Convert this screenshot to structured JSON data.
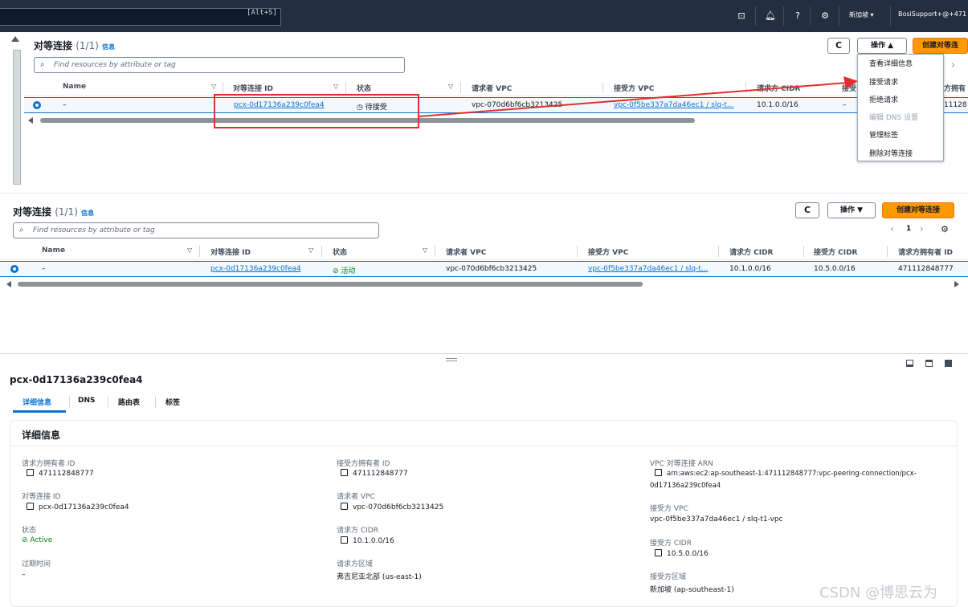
{
  "topbar": {
    "shortcut": "[Alt+S]",
    "region": "新加坡 ▾",
    "account": "BosiSupport+@+471"
  },
  "top_panel": {
    "title": "对等连接",
    "count": "(1/1)",
    "info": "信息",
    "search_placeholder": "Find resources by attribute or tag",
    "refresh": "C",
    "actions": "操作 ▲",
    "create": "创建对等连",
    "columns": [
      "Name",
      "对等连接 ID",
      "状态",
      "请求者 VPC",
      "接受方 VPC",
      "请求方 CIDR",
      "接受",
      "方拥有"
    ],
    "row": {
      "name": "–",
      "id": "pcx-0d17136a239c0fea4",
      "status": "待接受",
      "requester_vpc": "vpc-070d6bf6cb3213425",
      "accepter_vpc": "vpc-0f5be337a7da46ec1 / slq-t...",
      "req_cidr": "10.1.0.0/16",
      "acc_cidr": "–",
      "owner": "11128"
    },
    "menu": [
      "查看详细信息",
      "接受请求",
      "拒绝请求",
      "编辑 DNS 设置",
      "管理标签",
      "删除对等连接"
    ]
  },
  "bottom_panel": {
    "title": "对等连接",
    "count": "(1/1)",
    "info": "信息",
    "search_placeholder": "Find resources by attribute or tag",
    "refresh": "C",
    "actions": "操作 ▼",
    "create": "创建对等连接",
    "page": "1",
    "columns": [
      "Name",
      "对等连接 ID",
      "状态",
      "请求者 VPC",
      "接受方 VPC",
      "请求方 CIDR",
      "接受方 CIDR",
      "请求方拥有者 ID"
    ],
    "row": {
      "name": "–",
      "id": "pcx-0d17136a239c0fea4",
      "status": "活动",
      "requester_vpc": "vpc-070d6bf6cb3213425",
      "accepter_vpc": "vpc-0f5be337a7da46ec1 / slq-t...",
      "req_cidr": "10.1.0.0/16",
      "acc_cidr": "10.5.0.0/16",
      "owner": "471112848777"
    }
  },
  "details": {
    "title": "pcx-0d17136a239c0fea4",
    "tabs": [
      "详细信息",
      "DNS",
      "路由表",
      "标签"
    ],
    "section": "详细信息",
    "col1": [
      {
        "label": "请求方拥有者 ID",
        "value": "471112848777"
      },
      {
        "label": "对等连接 ID",
        "value": "pcx-0d17136a239c0fea4"
      },
      {
        "label": "状态",
        "value": "Active"
      },
      {
        "label": "过期时间",
        "value": "–"
      }
    ],
    "col2": [
      {
        "label": "接受方拥有者 ID",
        "value": "471112848777"
      },
      {
        "label": "请求者 VPC",
        "value": "vpc-070d6bf6cb3213425"
      },
      {
        "label": "请求方 CIDR",
        "value": "10.1.0.0/16"
      },
      {
        "label": "请求方区域",
        "value": "弗吉尼亚北部 (us-east-1)"
      }
    ],
    "col3": [
      {
        "label": "VPC 对等连接 ARN",
        "value1": "arn:aws:ec2:ap-southeast-1:471112848777:vpc-peering-connection/pcx-",
        "value2": "0d17136a239c0fea4"
      },
      {
        "label": "接受方 VPC",
        "value": "vpc-0f5be337a7da46ec1 / slq-t1-vpc"
      },
      {
        "label": "接受方 CIDR",
        "value": "10.5.0.0/16"
      },
      {
        "label": "接受方区域",
        "value": "新加坡 (ap-southeast-1)"
      }
    ]
  },
  "watermark": "CSDN @博思云为"
}
